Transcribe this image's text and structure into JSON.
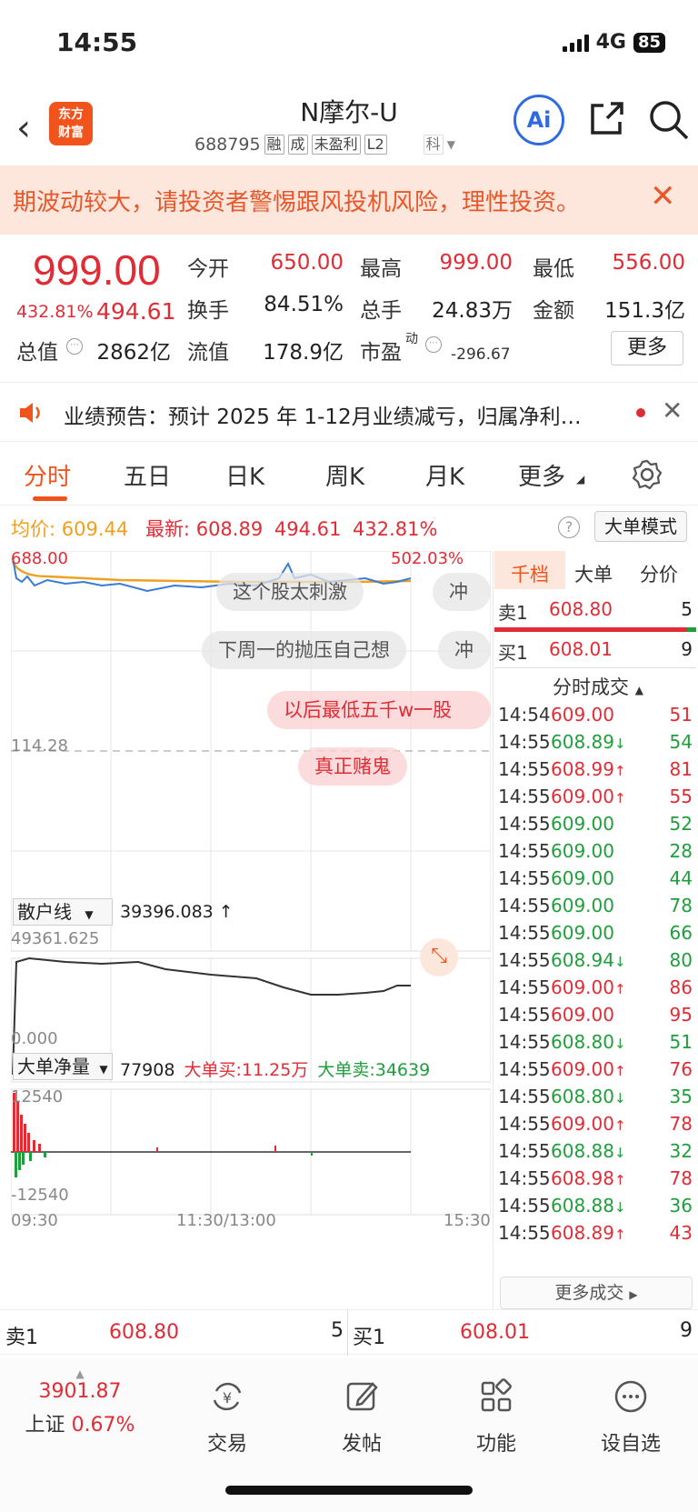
{
  "status": {
    "time": "14:55",
    "network": "4G",
    "battery": "85"
  },
  "header": {
    "logo": "东方财富",
    "name": "N摩尔-U",
    "code": "688795",
    "tags": [
      "融",
      "成",
      "未盈利",
      "L2"
    ],
    "board": "科",
    "ai_label": "Ai"
  },
  "risk_banner": {
    "text": "期波动较大，请投资者警惕跟风投机风险，理性投资。"
  },
  "quote": {
    "price": "999.00",
    "pct": "432.81%",
    "change": "494.61",
    "open_label": "今开",
    "open": "650.00",
    "high_label": "最高",
    "high": "999.00",
    "low_label": "最低",
    "low": "556.00",
    "turnover_label": "换手",
    "turnover": "84.51%",
    "volume_label": "总手",
    "volume": "24.83万",
    "amount_label": "金额",
    "amount": "151.3亿",
    "mcap_label": "总值",
    "mcap": "2862亿",
    "float_label": "流值",
    "float": "178.9亿",
    "pe_label": "市盈",
    "pe_sup": "动",
    "pe": "-296.67",
    "more": "更多"
  },
  "notice": {
    "text": "业绩预告：预计 2025 年 1-12月业绩减亏，归属净利…"
  },
  "tabs": [
    "分时",
    "五日",
    "日K",
    "周K",
    "月K",
    "更多"
  ],
  "info_line": {
    "avg_label": "均价:",
    "avg": "609.44",
    "latest_label": "最新:",
    "latest": "608.89",
    "chg": "494.61",
    "pct": "432.81%",
    "big_mode": "大单模式"
  },
  "chart": {
    "top_left": "688.00",
    "top_right": "502.03%",
    "mid": "114.28",
    "retail_label": "散户线",
    "retail_value": "39396.083 ↑",
    "retail_top": "49361.625",
    "retail_bottom": "0.000",
    "bigorder_label": "大单净量",
    "bigorder_value": "77908",
    "big_buy": "大单买:11.25万",
    "big_sell": "大单卖:34639",
    "big_top": "12540",
    "big_bottom": "-12540",
    "x_start": "09:30",
    "x_mid": "11:30/13:00",
    "x_end": "15:30",
    "danmu": [
      "这个股太刺激",
      "冲",
      "下周一的抛压自己想",
      "冲",
      "以后最低五千w一股",
      "真正赌鬼"
    ]
  },
  "right_panel": {
    "tabs": [
      "千档",
      "大单",
      "分价"
    ],
    "ask1": {
      "label": "卖1",
      "price": "608.80",
      "vol": "5"
    },
    "bid1": {
      "label": "买1",
      "price": "608.01",
      "vol": "9"
    },
    "ticks_title": "分时成交",
    "ticks": [
      {
        "t": "14:54",
        "p": "609.00",
        "a": "",
        "v": "51",
        "c": "r"
      },
      {
        "t": "14:55",
        "p": "608.89",
        "a": "↓",
        "v": "54",
        "c": "g"
      },
      {
        "t": "14:55",
        "p": "608.99",
        "a": "↑",
        "v": "81",
        "c": "r"
      },
      {
        "t": "14:55",
        "p": "609.00",
        "a": "↑",
        "v": "55",
        "c": "r"
      },
      {
        "t": "14:55",
        "p": "609.00",
        "a": "",
        "v": "52",
        "c": "g"
      },
      {
        "t": "14:55",
        "p": "609.00",
        "a": "",
        "v": "28",
        "c": "g"
      },
      {
        "t": "14:55",
        "p": "609.00",
        "a": "",
        "v": "44",
        "c": "g"
      },
      {
        "t": "14:55",
        "p": "609.00",
        "a": "",
        "v": "78",
        "c": "g"
      },
      {
        "t": "14:55",
        "p": "609.00",
        "a": "",
        "v": "66",
        "c": "g"
      },
      {
        "t": "14:55",
        "p": "608.94",
        "a": "↓",
        "v": "80",
        "c": "g"
      },
      {
        "t": "14:55",
        "p": "609.00",
        "a": "↑",
        "v": "86",
        "c": "r"
      },
      {
        "t": "14:55",
        "p": "609.00",
        "a": "",
        "v": "95",
        "c": "r"
      },
      {
        "t": "14:55",
        "p": "608.80",
        "a": "↓",
        "v": "51",
        "c": "g"
      },
      {
        "t": "14:55",
        "p": "609.00",
        "a": "↑",
        "v": "76",
        "c": "r"
      },
      {
        "t": "14:55",
        "p": "608.80",
        "a": "↓",
        "v": "35",
        "c": "g"
      },
      {
        "t": "14:55",
        "p": "609.00",
        "a": "↑",
        "v": "78",
        "c": "r"
      },
      {
        "t": "14:55",
        "p": "608.88",
        "a": "↓",
        "v": "32",
        "c": "g"
      },
      {
        "t": "14:55",
        "p": "608.98",
        "a": "↑",
        "v": "78",
        "c": "r"
      },
      {
        "t": "14:55",
        "p": "608.88",
        "a": "↓",
        "v": "36",
        "c": "g"
      },
      {
        "t": "14:55",
        "p": "608.89",
        "a": "↑",
        "v": "43",
        "c": "r"
      }
    ],
    "more_ticks": "更多成交"
  },
  "bidask": {
    "ask_label": "卖1",
    "ask_price": "608.80",
    "ask_vol": "5",
    "bid_label": "买1",
    "bid_price": "608.01",
    "bid_vol": "9"
  },
  "bottom_nav": {
    "index_value": "3901.87",
    "index_name": "上证",
    "index_pct": "0.67%",
    "items": [
      "交易",
      "发帖",
      "功能",
      "设自选"
    ]
  },
  "colors": {
    "up": "#e02c35",
    "down": "#1f9e3c",
    "accent": "#f2531d",
    "avg_line": "#f0a020",
    "price_line": "#3a7bd5"
  }
}
